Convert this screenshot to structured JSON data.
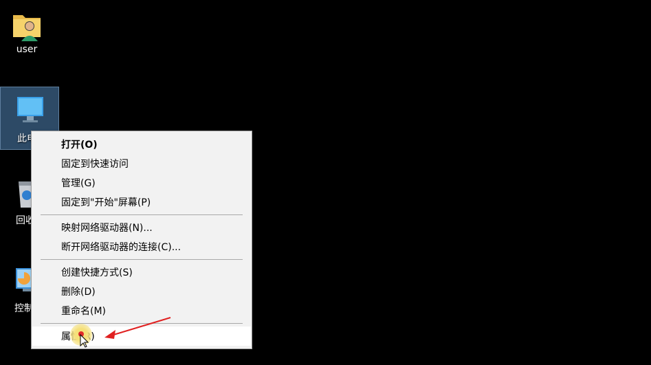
{
  "desktop": {
    "icons": [
      {
        "label": "user",
        "icon": "user-folder-icon"
      },
      {
        "label": "此电",
        "icon": "computer-icon"
      },
      {
        "label": "回收",
        "icon": "recycle-bin-icon"
      },
      {
        "label": "控制面",
        "icon": "control-panel-icon"
      }
    ]
  },
  "context_menu": {
    "groups": [
      [
        {
          "label": "打开(O)",
          "bold": true
        },
        {
          "label": "固定到快速访问"
        },
        {
          "label": "管理(G)"
        },
        {
          "label": "固定到\"开始\"屏幕(P)"
        }
      ],
      [
        {
          "label": "映射网络驱动器(N)..."
        },
        {
          "label": "断开网络驱动器的连接(C)..."
        }
      ],
      [
        {
          "label": "创建快捷方式(S)"
        },
        {
          "label": "删除(D)"
        },
        {
          "label": "重命名(M)"
        }
      ],
      [
        {
          "label": "属性(R)",
          "highlighted": true
        }
      ]
    ]
  },
  "annotation": {
    "arrow_color": "#e02020"
  }
}
